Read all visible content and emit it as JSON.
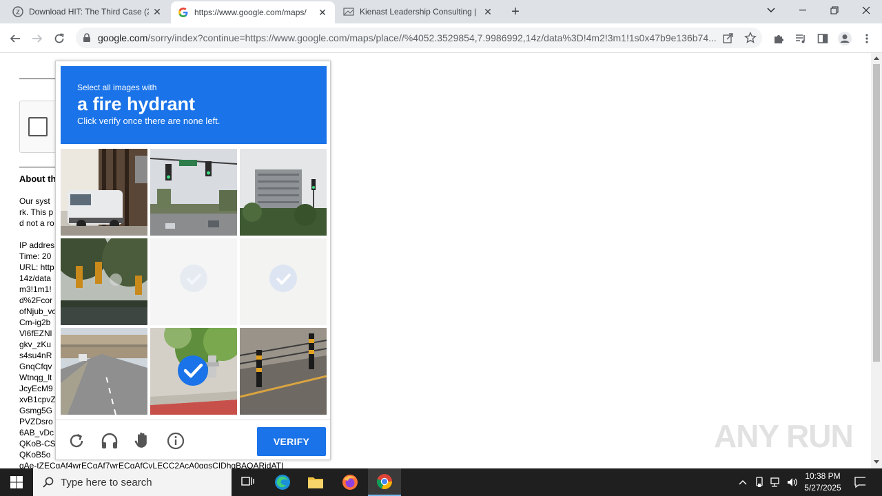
{
  "browser": {
    "tabs": [
      {
        "title": "Download HIT: The Third Case (2",
        "favicon": "z-library-icon"
      },
      {
        "title": "https://www.google.com/maps/",
        "favicon": "google-icon"
      },
      {
        "title": "Kienast Leadership Consulting | ",
        "favicon": "page-icon"
      }
    ],
    "url_host": "google.com",
    "url_path": "/sorry/index?continue=https://www.google.com/maps/place//%4052.3529854,7.9986992,14z/data%3D!4m2!3m1!1s0x47b9e136b74..."
  },
  "background": {
    "heading": "About th",
    "lines": [
      "Our syst",
      "rk. This p",
      "d not a ro",
      "",
      "IP addres",
      "Time: 20",
      "URL: http",
      "14z/data",
      "m3!1m1!",
      "d%2Fcor",
      "ofNjub_vo",
      "Cm-ig2b",
      "Vl6fEZNl",
      "gkv_zKu",
      "s4su4nR",
      "GnqCfqv",
      "Wtnqg_lt",
      "JcyEcM9",
      "xvB1cpvZ",
      "Gsmg5G",
      "PVZDsro",
      "6AB_vDc",
      "QKoB-CS",
      "QKoB5o",
      "gAe-tZECgAf4wrECgAf7wrECgAfCvLECC2AcA0ggsCIDhgBAOARidATI"
    ]
  },
  "captcha": {
    "instruction_small": "Select all images with",
    "instruction_big": "a fire hydrant",
    "instruction_sub": "Click verify once there are none left.",
    "verify_label": "VERIFY",
    "tiles": [
      {
        "desc": "van-parked-by-building",
        "selected": false
      },
      {
        "desc": "traffic-lights-street",
        "selected": false
      },
      {
        "desc": "apartment-building-traffic-light",
        "selected": false
      },
      {
        "desc": "traffic-lights-trees",
        "selected": false
      },
      {
        "desc": "faded-selected",
        "selected": true
      },
      {
        "desc": "faded-selected",
        "selected": true
      },
      {
        "desc": "highway-overpass",
        "selected": false
      },
      {
        "desc": "fire-hydrant-plants",
        "selected": true
      },
      {
        "desc": "road-bollards",
        "selected": false
      }
    ],
    "accent": "#1a73e8"
  },
  "watermark": "ANY RUN",
  "taskbar": {
    "search_placeholder": "Type here to search",
    "time": "10:38 PM",
    "date": "5/27/2025"
  }
}
